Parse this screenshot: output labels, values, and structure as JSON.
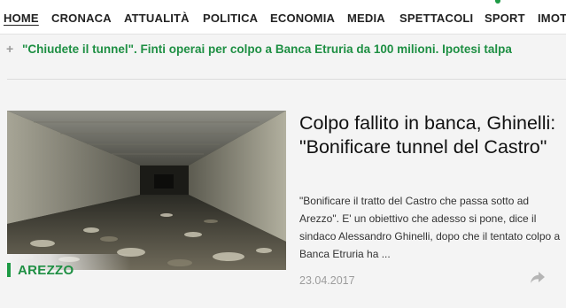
{
  "nav": {
    "items": [
      {
        "label": "HOME",
        "active": true
      },
      {
        "label": "CRONACA"
      },
      {
        "label": "ATTUALITÀ"
      },
      {
        "label": "POLITICA"
      },
      {
        "label": "ECONOMIA"
      },
      {
        "label": "MEDIA"
      },
      {
        "label": "SPETTACOLI"
      },
      {
        "label": "SPORT"
      },
      {
        "label": "IMOT"
      }
    ]
  },
  "ticker": {
    "headline": "\"Chiudete il tunnel\". Finti operai per colpo a Banca Etruria da 100 milioni. Ipotesi talpa"
  },
  "article": {
    "category": "AREZZO",
    "title": "Colpo fallito in banca, Ghinelli: \"Bonificare tunnel del Castro\"",
    "summary": "\"Bonificare il tratto del Castro che passa sotto ad Arezzo\". E' un obiettivo che adesso si pone, dice il sindaco Alessandro Ghinelli, dopo che il tentato colpo a Banca Etruria ha ...",
    "date": "23.04.2017"
  },
  "colors": {
    "accent_green": "#1e8f43",
    "background": "#f4f4f4",
    "text_dark": "#111111",
    "text_muted": "#9c9c9c"
  },
  "icons": {
    "ticker_bullet": "plus-icon",
    "share": "share-arrow-icon"
  }
}
